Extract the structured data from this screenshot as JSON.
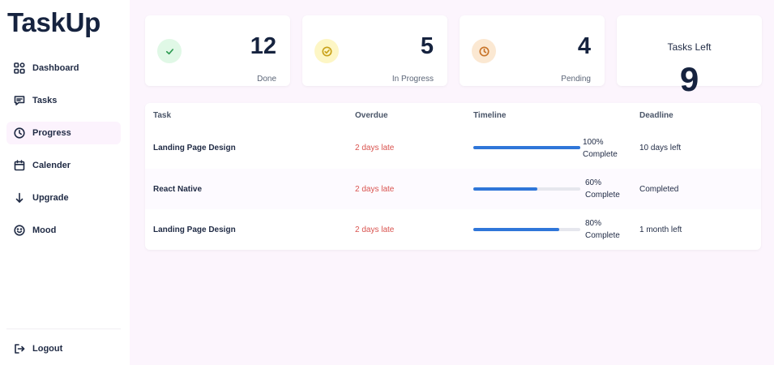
{
  "app": {
    "name": "TaskUp"
  },
  "sidebar": {
    "items": [
      {
        "label": "Dashboard",
        "icon": "dashboard-icon",
        "active": false
      },
      {
        "label": "Tasks",
        "icon": "chat-icon",
        "active": false
      },
      {
        "label": "Progress",
        "icon": "clock-icon",
        "active": true
      },
      {
        "label": "Calender",
        "icon": "calendar-icon",
        "active": false
      },
      {
        "label": "Upgrade",
        "icon": "arrow-down-icon",
        "active": false
      },
      {
        "label": "Mood",
        "icon": "smile-icon",
        "active": false
      }
    ],
    "logout": {
      "label": "Logout",
      "icon": "logout-icon"
    }
  },
  "stats": [
    {
      "value": "12",
      "label": "Done",
      "icon": "check-icon",
      "bg": "#e0f8e6",
      "color": "#2e9b52"
    },
    {
      "value": "5",
      "label": "In Progress",
      "icon": "check-circle-icon",
      "bg": "#fdf6c5",
      "color": "#c9a21a"
    },
    {
      "value": "4",
      "label": "Pending",
      "icon": "clock-icon",
      "bg": "#fbe8d2",
      "color": "#c8742a"
    }
  ],
  "tasks_left": {
    "label": "Tasks Left",
    "value": "9"
  },
  "table": {
    "headers": {
      "task": "Task",
      "overdue": "Overdue",
      "timeline": "Timeline",
      "deadline": "Deadline"
    },
    "rows": [
      {
        "task": "Landing Page Design",
        "overdue": "2 days late",
        "progress": 100,
        "pct": "100%",
        "status": "Complete",
        "deadline": "10 days left"
      },
      {
        "task": "React Native",
        "overdue": "2 days late",
        "progress": 60,
        "pct": "60%",
        "status": "Complete",
        "deadline": "Completed"
      },
      {
        "task": "Landing Page Design",
        "overdue": "2 days late",
        "progress": 80,
        "pct": "80%",
        "status": "Complete",
        "deadline": "1 month left"
      }
    ]
  },
  "colors": {
    "accent": "#2f76d9",
    "overdue": "#d9534f",
    "background": "#fcf5fd"
  }
}
